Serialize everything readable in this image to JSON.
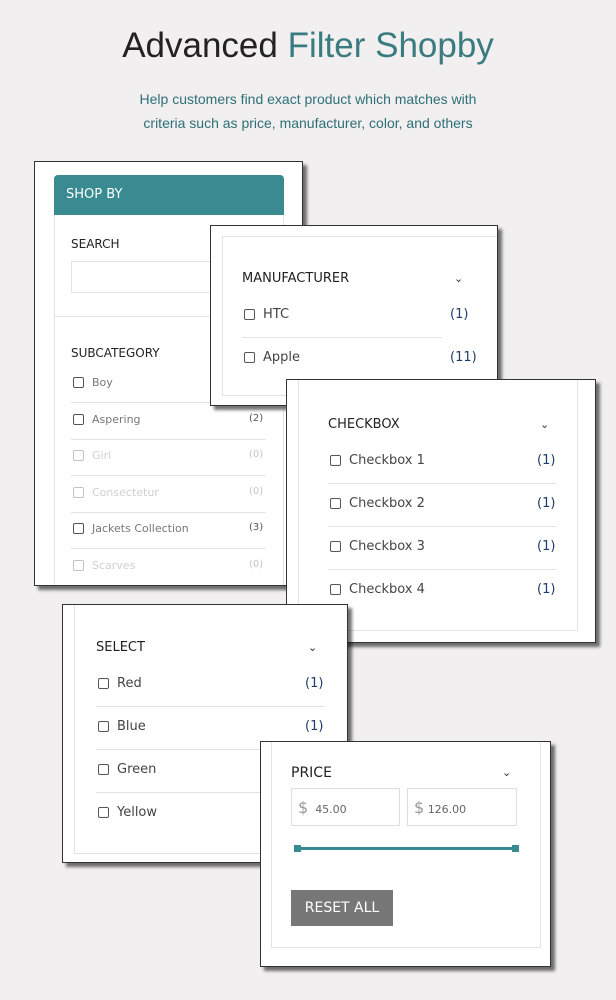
{
  "hero": {
    "title_a": "Advanced",
    "title_b": "Filter Shopby",
    "subtitle_1": "Help customers find exact product which matches with",
    "subtitle_2": "criteria such as price, manufacturer, color, and others"
  },
  "accent": "#3a8a91",
  "shopby": {
    "header": "SHOP BY",
    "search_label": "SEARCH",
    "search_value": "",
    "subcategory_label": "SUBCATEGORY",
    "items": [
      {
        "label": "Boy",
        "count": "",
        "enabled": true
      },
      {
        "label": "Aspering",
        "count": "(2)",
        "enabled": true
      },
      {
        "label": "Girl",
        "count": "(0)",
        "enabled": false
      },
      {
        "label": "Consectetur",
        "count": "(0)",
        "enabled": false
      },
      {
        "label": "Jackets Collection",
        "count": "(3)",
        "enabled": true
      },
      {
        "label": "Scarves",
        "count": "(0)",
        "enabled": false
      }
    ]
  },
  "manufacturer": {
    "title": "MANUFACTURER",
    "items": [
      {
        "label": "HTC",
        "count": "(1)"
      },
      {
        "label": "Apple",
        "count": "(11)"
      }
    ]
  },
  "checkbox": {
    "title": "CHECKBOX",
    "items": [
      {
        "label": "Checkbox 1",
        "count": "(1)"
      },
      {
        "label": "Checkbox 2",
        "count": "(1)"
      },
      {
        "label": "Checkbox 3",
        "count": "(1)"
      },
      {
        "label": "Checkbox 4",
        "count": "(1)"
      }
    ]
  },
  "select": {
    "title": "SELECT",
    "items": [
      {
        "label": "Red",
        "count": "(1)"
      },
      {
        "label": "Blue",
        "count": "(1)"
      },
      {
        "label": "Green",
        "count": ""
      },
      {
        "label": "Yellow",
        "count": ""
      }
    ]
  },
  "price": {
    "title": "PRICE",
    "currency": "$",
    "min": "45.00",
    "max": "126.00",
    "reset_label": "RESET ALL"
  }
}
